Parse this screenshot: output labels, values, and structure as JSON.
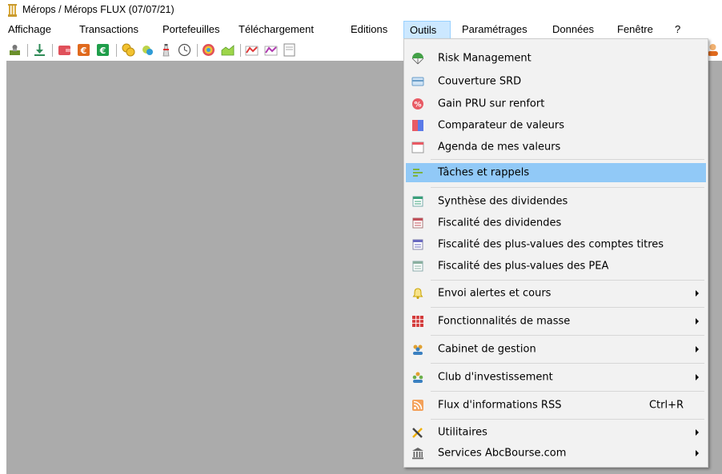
{
  "window": {
    "title": "Mérops / Mérops FLUX (07/07/21)"
  },
  "menubar": {
    "items": [
      "Affichage",
      "Transactions",
      "Portefeuilles",
      "Téléchargement",
      "Editions",
      "Outils",
      "Paramétrages",
      "Données",
      "Fenêtre",
      "?"
    ],
    "active": "Outils"
  },
  "toolbar": {
    "icons": [
      "portfolio-icon",
      "download-icon",
      "wallet-icon",
      "currency-orange-icon",
      "currency-green-icon",
      "coins-icon",
      "coins-small-icon",
      "lighthouse-icon",
      "clock-icon",
      "target-chart-icon",
      "area-chart-icon",
      "line-chart-icon",
      "line-chart-purple-icon",
      "sheet-icon",
      "user-icon"
    ]
  },
  "outils_menu": {
    "items": [
      {
        "label": "Risk Management",
        "icon": "parachute-icon"
      },
      {
        "label": "Couverture SRD",
        "icon": "card-icon"
      },
      {
        "label": "Gain PRU sur renfort",
        "icon": "percent-badge-icon"
      },
      {
        "label": "Comparateur de valeurs",
        "icon": "compare-icon"
      },
      {
        "label": "Agenda de mes valeurs",
        "icon": "calendar-icon"
      },
      {
        "label": "Tâches et rappels",
        "icon": "tasks-icon",
        "highlighted": true
      },
      {
        "label": "Synthèse des dividendes",
        "icon": "sheet-green-icon"
      },
      {
        "label": "Fiscalité des dividendes",
        "icon": "sheet-red-icon"
      },
      {
        "label": "Fiscalité des plus-values des comptes titres",
        "icon": "sheet-purple-icon"
      },
      {
        "label": "Fiscalité des plus-values des PEA",
        "icon": "sheet-teal-icon"
      },
      {
        "label": "Envoi alertes et cours",
        "icon": "bell-icon",
        "submenu": true
      },
      {
        "label": "Fonctionnalités de masse",
        "icon": "grid-icon",
        "submenu": true
      },
      {
        "label": "Cabinet de gestion",
        "icon": "people-icon",
        "submenu": true
      },
      {
        "label": "Club d'investissement",
        "icon": "group-icon",
        "submenu": true
      },
      {
        "label": "Flux d'informations RSS",
        "icon": "rss-icon",
        "shortcut": "Ctrl+R"
      },
      {
        "label": "Utilitaires",
        "icon": "tools-icon",
        "submenu": true
      },
      {
        "label": "Services AbcBourse.com",
        "icon": "bank-icon",
        "submenu": true
      }
    ]
  }
}
